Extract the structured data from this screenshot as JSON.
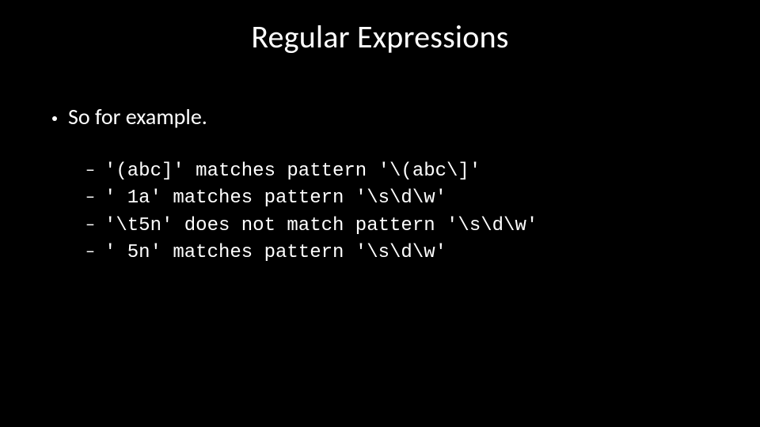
{
  "title": "Regular Expressions",
  "bullet1": "So for example.",
  "examples": {
    "0": "'(abc]' matches pattern '\\(abc\\]'",
    "1": "' 1a' matches pattern '\\s\\d\\w'",
    "2": "'\\t5n' does not match pattern '\\s\\d\\w'",
    "3": "' 5n' matches pattern '\\s\\d\\w'"
  }
}
